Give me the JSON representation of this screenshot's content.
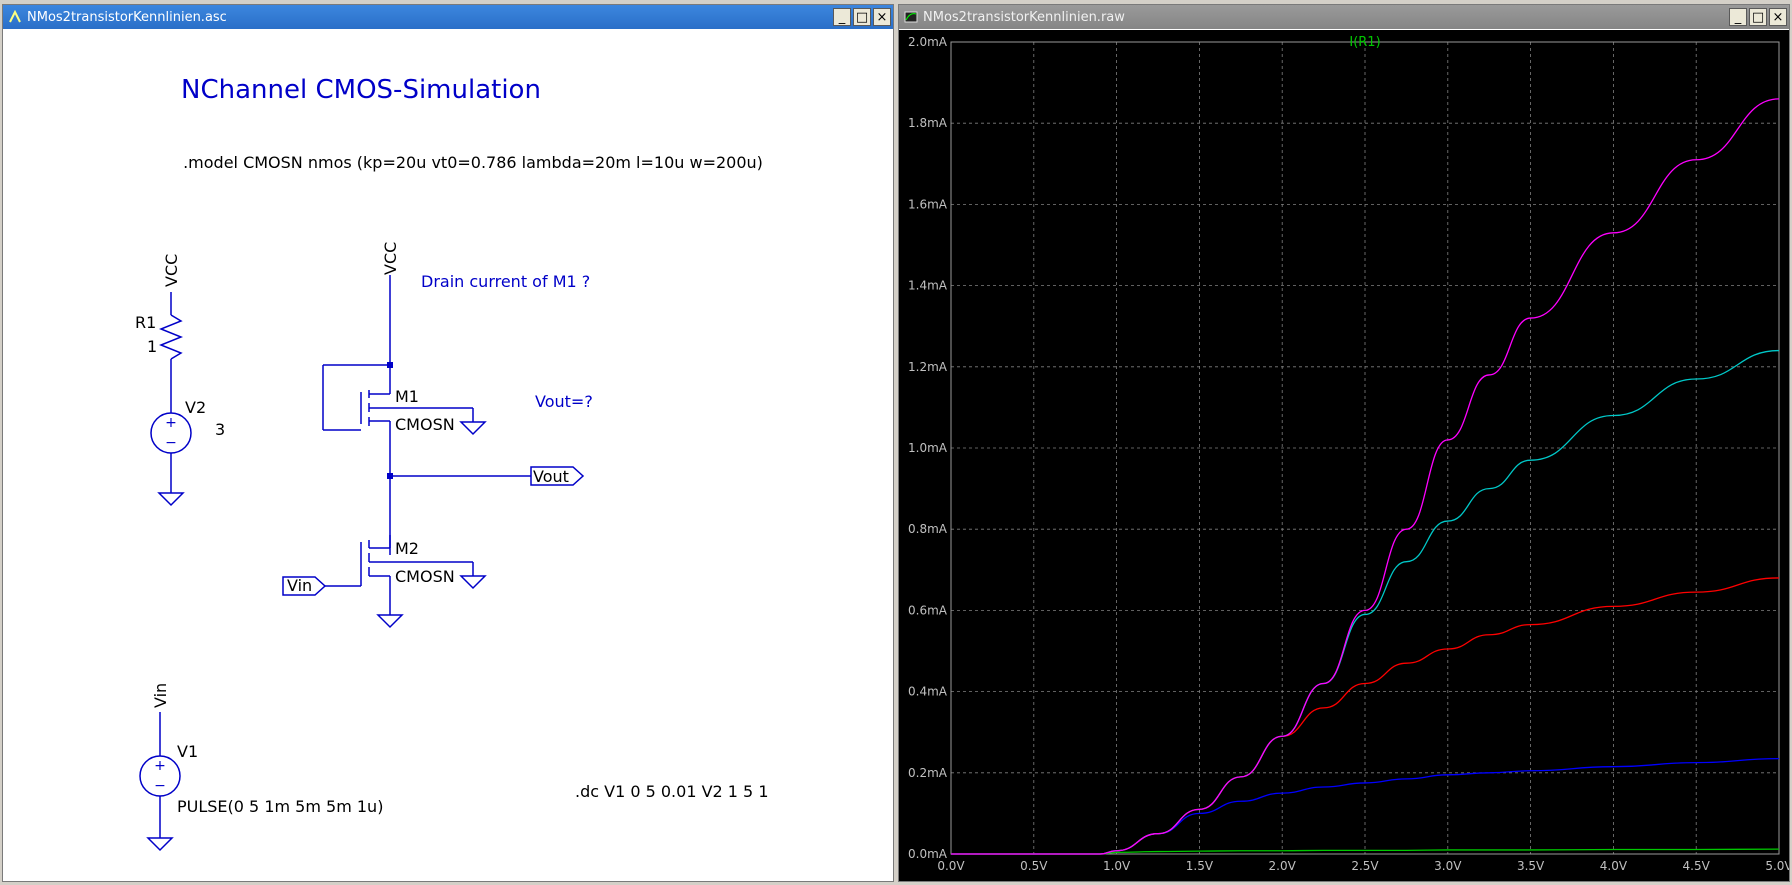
{
  "schematic_window": {
    "title": "NMos2transistorKennlinien.asc",
    "min_label": "_",
    "max_label": "□",
    "close_label": "×"
  },
  "waveform_window": {
    "title": "NMos2transistorKennlinien.raw",
    "min_label": "_",
    "max_label": "□",
    "close_label": "×"
  },
  "schematic": {
    "title": "NChannel CMOS-Simulation",
    "model_directive": ".model CMOSN nmos (kp=20u vt0=0.786 lambda=20m l=10u w=200u)",
    "question_drain": "Drain current of M1 ?",
    "question_vout": "Vout=?",
    "dc_directive": ".dc V1 0 5 0.01 V2 1 5 1",
    "vcc_label_1": "VCC",
    "vcc_label_2": "VCC",
    "r1_name": "R1",
    "r1_value": "1",
    "v2_name": "V2",
    "v2_value": "3",
    "m1_name": "M1",
    "m1_model": "CMOSN",
    "m2_name": "M2",
    "m2_model": "CMOSN",
    "vout_port": "Vout",
    "vin_port": "Vin",
    "vin_label": "Vin",
    "v1_name": "V1",
    "v1_value": "PULSE(0 5 1m 5m 5m 1u)",
    "plus_sign": "+",
    "minus_sign": "−",
    "colors": {
      "wire": "#0000c8",
      "text": "#000000",
      "comment": "#0000ff"
    }
  },
  "chart_data": {
    "type": "line",
    "title": "I(R1)",
    "xlabel": "",
    "ylabel": "",
    "xlim": [
      0,
      5
    ],
    "ylim": [
      0,
      2.0
    ],
    "x_unit": "V",
    "y_unit": "mA",
    "grid": true,
    "background": "#000000",
    "x_ticks": [
      "0.0V",
      "0.5V",
      "1.0V",
      "1.5V",
      "2.0V",
      "2.5V",
      "3.0V",
      "3.5V",
      "4.0V",
      "4.5V",
      "5.0V"
    ],
    "y_ticks": [
      "0.0mA",
      "0.2mA",
      "0.4mA",
      "0.6mA",
      "0.8mA",
      "1.0mA",
      "1.2mA",
      "1.4mA",
      "1.6mA",
      "1.8mA",
      "2.0mA"
    ],
    "x": [
      0,
      0.5,
      0.9,
      1.0,
      1.25,
      1.5,
      1.75,
      2.0,
      2.25,
      2.5,
      2.75,
      3.0,
      3.25,
      3.5,
      4.0,
      4.5,
      5.0
    ],
    "series": [
      {
        "color": "#00c800",
        "values": [
          0,
          0,
          0,
          0.004,
          0.006,
          0.007,
          0.008,
          0.008,
          0.009,
          0.009,
          0.009,
          0.01,
          0.01,
          0.01,
          0.011,
          0.011,
          0.012
        ]
      },
      {
        "color": "#0000ff",
        "values": [
          0,
          0,
          0,
          0.008,
          0.05,
          0.1,
          0.13,
          0.15,
          0.165,
          0.175,
          0.185,
          0.195,
          0.2,
          0.205,
          0.215,
          0.225,
          0.235
        ]
      },
      {
        "color": "#ff0000",
        "values": [
          0,
          0,
          0,
          0.008,
          0.05,
          0.11,
          0.19,
          0.29,
          0.36,
          0.42,
          0.47,
          0.505,
          0.54,
          0.565,
          0.61,
          0.645,
          0.68
        ]
      },
      {
        "color": "#00c8c8",
        "values": [
          0,
          0,
          0,
          0.008,
          0.05,
          0.11,
          0.19,
          0.29,
          0.42,
          0.59,
          0.72,
          0.82,
          0.9,
          0.97,
          1.08,
          1.17,
          1.24
        ]
      },
      {
        "color": "#ff00ff",
        "values": [
          0,
          0,
          0,
          0.008,
          0.05,
          0.11,
          0.19,
          0.29,
          0.42,
          0.6,
          0.8,
          1.02,
          1.18,
          1.32,
          1.53,
          1.71,
          1.86
        ]
      }
    ]
  }
}
